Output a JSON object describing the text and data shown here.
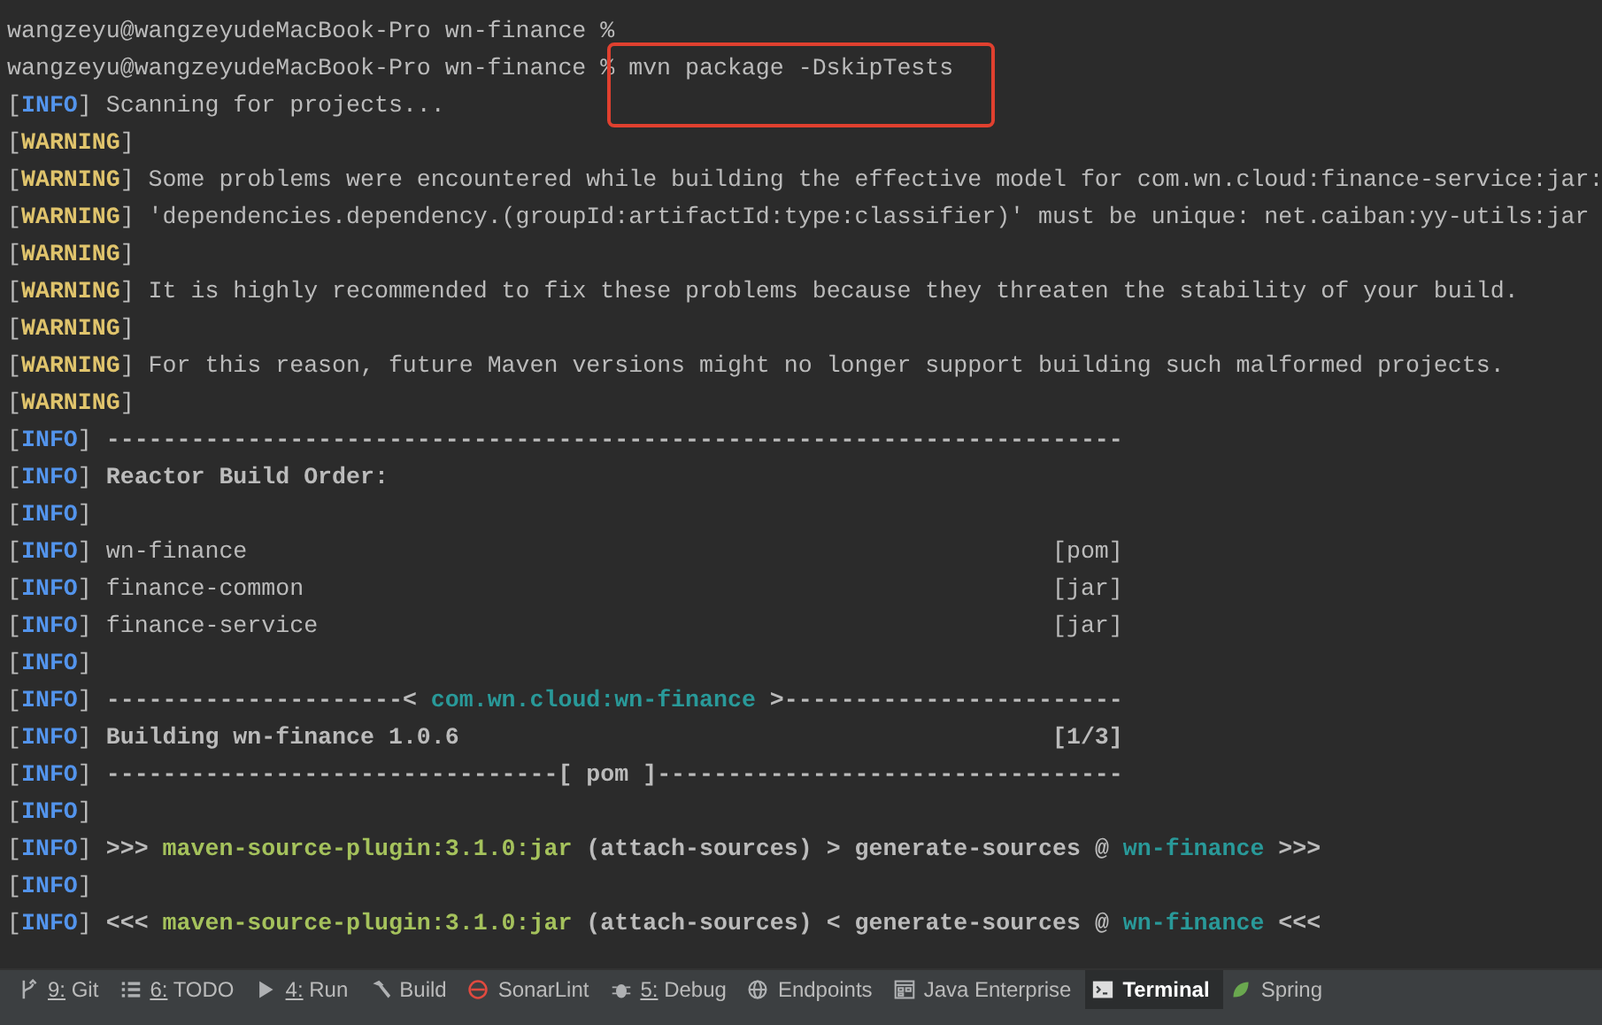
{
  "terminal": {
    "lines": [
      {
        "parts": [
          {
            "kind": "text",
            "text": "wangzeyu@wangzeyudeMacBook-Pro wn-finance %"
          }
        ]
      },
      {
        "parts": [
          {
            "kind": "text",
            "text": "wangzeyu@wangzeyudeMacBook-Pro wn-finance % mvn package -DskipTests"
          }
        ]
      },
      {
        "parts": [
          {
            "kind": "bracket",
            "text": "["
          },
          {
            "kind": "info",
            "text": "INFO"
          },
          {
            "kind": "bracket",
            "text": "]"
          },
          {
            "kind": "text",
            "text": " Scanning for projects..."
          }
        ]
      },
      {
        "parts": [
          {
            "kind": "bracket",
            "text": "["
          },
          {
            "kind": "warning",
            "text": "WARNING"
          },
          {
            "kind": "bracket",
            "text": "]"
          }
        ]
      },
      {
        "parts": [
          {
            "kind": "bracket",
            "text": "["
          },
          {
            "kind": "warning",
            "text": "WARNING"
          },
          {
            "kind": "bracket",
            "text": "]"
          },
          {
            "kind": "text",
            "text": " Some problems were encountered while building the effective model for com.wn.cloud:finance-service:jar:"
          }
        ]
      },
      {
        "parts": [
          {
            "kind": "bracket",
            "text": "["
          },
          {
            "kind": "warning",
            "text": "WARNING"
          },
          {
            "kind": "bracket",
            "text": "]"
          },
          {
            "kind": "text",
            "text": " 'dependencies.dependency.(groupId:artifactId:type:classifier)' must be unique: net.caiban:yy-utils:jar"
          }
        ]
      },
      {
        "parts": [
          {
            "kind": "bracket",
            "text": "["
          },
          {
            "kind": "warning",
            "text": "WARNING"
          },
          {
            "kind": "bracket",
            "text": "]"
          }
        ]
      },
      {
        "parts": [
          {
            "kind": "bracket",
            "text": "["
          },
          {
            "kind": "warning",
            "text": "WARNING"
          },
          {
            "kind": "bracket",
            "text": "]"
          },
          {
            "kind": "text",
            "text": " It is highly recommended to fix these problems because they threaten the stability of your build."
          }
        ]
      },
      {
        "parts": [
          {
            "kind": "bracket",
            "text": "["
          },
          {
            "kind": "warning",
            "text": "WARNING"
          },
          {
            "kind": "bracket",
            "text": "]"
          }
        ]
      },
      {
        "parts": [
          {
            "kind": "bracket",
            "text": "["
          },
          {
            "kind": "warning",
            "text": "WARNING"
          },
          {
            "kind": "bracket",
            "text": "]"
          },
          {
            "kind": "text",
            "text": " For this reason, future Maven versions might no longer support building such malformed projects."
          }
        ]
      },
      {
        "parts": [
          {
            "kind": "bracket",
            "text": "["
          },
          {
            "kind": "warning",
            "text": "WARNING"
          },
          {
            "kind": "bracket",
            "text": "]"
          }
        ]
      },
      {
        "parts": [
          {
            "kind": "bracket",
            "text": "["
          },
          {
            "kind": "info",
            "text": "INFO"
          },
          {
            "kind": "bracket",
            "text": "]"
          },
          {
            "kind": "bold",
            "text": " ------------------------------------------------------------------------"
          }
        ]
      },
      {
        "parts": [
          {
            "kind": "bracket",
            "text": "["
          },
          {
            "kind": "info",
            "text": "INFO"
          },
          {
            "kind": "bracket",
            "text": "]"
          },
          {
            "kind": "bold",
            "text": " Reactor Build Order:"
          }
        ]
      },
      {
        "parts": [
          {
            "kind": "bracket",
            "text": "["
          },
          {
            "kind": "info",
            "text": "INFO"
          },
          {
            "kind": "bracket",
            "text": "]"
          }
        ]
      },
      {
        "parts": [
          {
            "kind": "bracket",
            "text": "["
          },
          {
            "kind": "info",
            "text": "INFO"
          },
          {
            "kind": "bracket",
            "text": "]"
          },
          {
            "kind": "text",
            "text": " wn-finance                                                         [pom]"
          }
        ]
      },
      {
        "parts": [
          {
            "kind": "bracket",
            "text": "["
          },
          {
            "kind": "info",
            "text": "INFO"
          },
          {
            "kind": "bracket",
            "text": "]"
          },
          {
            "kind": "text",
            "text": " finance-common                                                     [jar]"
          }
        ]
      },
      {
        "parts": [
          {
            "kind": "bracket",
            "text": "["
          },
          {
            "kind": "info",
            "text": "INFO"
          },
          {
            "kind": "bracket",
            "text": "]"
          },
          {
            "kind": "text",
            "text": " finance-service                                                    [jar]"
          }
        ]
      },
      {
        "parts": [
          {
            "kind": "bracket",
            "text": "["
          },
          {
            "kind": "info",
            "text": "INFO"
          },
          {
            "kind": "bracket",
            "text": "]"
          }
        ]
      },
      {
        "parts": [
          {
            "kind": "bracket",
            "text": "["
          },
          {
            "kind": "info",
            "text": "INFO"
          },
          {
            "kind": "bracket",
            "text": "]"
          },
          {
            "kind": "bold",
            "text": " ---------------------< "
          },
          {
            "kind": "link",
            "text": "com.wn.cloud:wn-finance"
          },
          {
            "kind": "bold",
            "text": " >------------------------"
          }
        ]
      },
      {
        "parts": [
          {
            "kind": "bracket",
            "text": "["
          },
          {
            "kind": "info",
            "text": "INFO"
          },
          {
            "kind": "bracket",
            "text": "]"
          },
          {
            "kind": "bold",
            "text": " Building wn-finance 1.0.6                                          [1/3]"
          }
        ]
      },
      {
        "parts": [
          {
            "kind": "bracket",
            "text": "["
          },
          {
            "kind": "info",
            "text": "INFO"
          },
          {
            "kind": "bracket",
            "text": "]"
          },
          {
            "kind": "bold",
            "text": " --------------------------------[ pom ]---------------------------------"
          }
        ]
      },
      {
        "parts": [
          {
            "kind": "bracket",
            "text": "["
          },
          {
            "kind": "info",
            "text": "INFO"
          },
          {
            "kind": "bracket",
            "text": "]"
          }
        ]
      },
      {
        "parts": [
          {
            "kind": "bracket",
            "text": "["
          },
          {
            "kind": "info",
            "text": "INFO"
          },
          {
            "kind": "bracket",
            "text": "]"
          },
          {
            "kind": "bold",
            "text": " >>> "
          },
          {
            "kind": "plugin",
            "text": "maven-source-plugin:3.1.0:jar"
          },
          {
            "kind": "bold",
            "text": " (attach-sources) > generate-sources @ "
          },
          {
            "kind": "link",
            "text": "wn-finance"
          },
          {
            "kind": "bold",
            "text": " >>>"
          }
        ]
      },
      {
        "parts": [
          {
            "kind": "bracket",
            "text": "["
          },
          {
            "kind": "info",
            "text": "INFO"
          },
          {
            "kind": "bracket",
            "text": "]"
          }
        ]
      },
      {
        "parts": [
          {
            "kind": "bracket",
            "text": "["
          },
          {
            "kind": "info",
            "text": "INFO"
          },
          {
            "kind": "bracket",
            "text": "]"
          },
          {
            "kind": "bold",
            "text": " <<< "
          },
          {
            "kind": "plugin",
            "text": "maven-source-plugin:3.1.0:jar"
          },
          {
            "kind": "bold",
            "text": " (attach-sources) < generate-sources @ "
          },
          {
            "kind": "link",
            "text": "wn-finance"
          },
          {
            "kind": "bold",
            "text": " <<<"
          }
        ]
      }
    ]
  },
  "tool_tabs": [
    {
      "key": "9:",
      "label": " Git",
      "selected": false
    },
    {
      "key": "6:",
      "label": " TODO",
      "selected": false
    },
    {
      "key": "4:",
      "label": " Run",
      "selected": false
    },
    {
      "label": "Build",
      "selected": false
    },
    {
      "label": "SonarLint",
      "selected": false
    },
    {
      "key": "5:",
      "label": " Debug",
      "selected": false
    },
    {
      "label": "Endpoints",
      "selected": false
    },
    {
      "label": "Java Enterprise",
      "selected": false
    },
    {
      "label": "Terminal",
      "selected": true
    },
    {
      "label": "Spring",
      "selected": false
    }
  ]
}
